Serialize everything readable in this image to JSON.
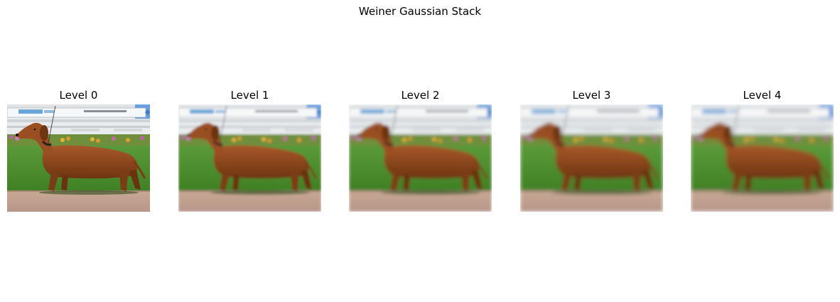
{
  "figure": {
    "title": "Weiner Gaussian Stack"
  },
  "panels": [
    {
      "label": "Level 0",
      "blur": 0
    },
    {
      "label": "Level 1",
      "blur": 1.6
    },
    {
      "label": "Level 2",
      "blur": 2.2
    },
    {
      "label": "Level 3",
      "blur": 2.6
    },
    {
      "label": "Level 4",
      "blur": 2.9
    }
  ]
}
